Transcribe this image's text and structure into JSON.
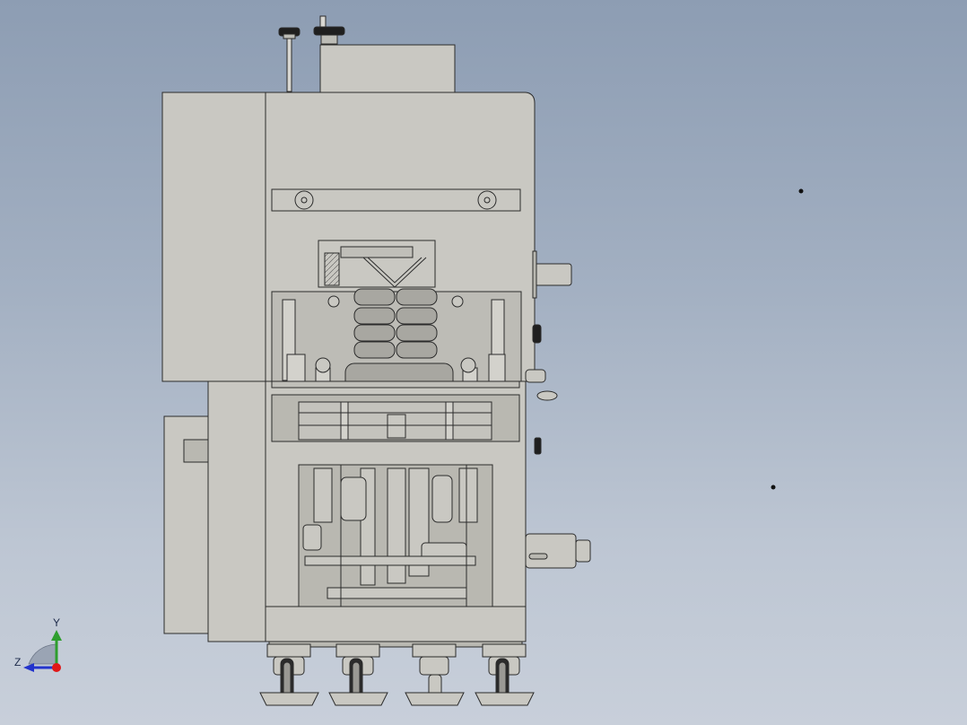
{
  "viewport": {
    "background_top": "#8d9db3",
    "background_bottom": "#c8cfda"
  },
  "model": {
    "body_color": "#c9c8c2",
    "body_shade": "#b9b8b1",
    "edge_color": "#2b2b2b",
    "roller_color": "#a8a7a1",
    "dark_part_color": "#1f1f1f"
  },
  "triad": {
    "y_label": "Y",
    "z_label": "Z",
    "y_color": "#2e9e2e",
    "z_color": "#2233cc",
    "x_color": "#e01818"
  }
}
